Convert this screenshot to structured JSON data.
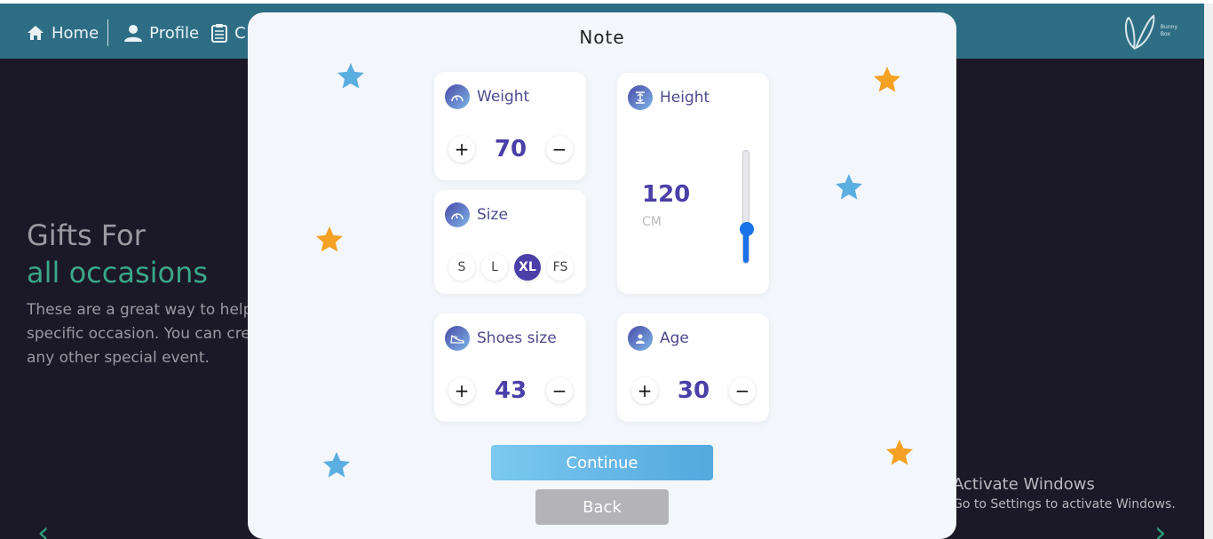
{
  "nav": {
    "items": [
      {
        "label": "Home",
        "icon": "home-icon"
      },
      {
        "label": "Profile",
        "icon": "user-icon"
      },
      {
        "label": "C",
        "icon": "clipboard-icon"
      }
    ]
  },
  "logo": {
    "line1": "Bunny",
    "line2": "Box"
  },
  "hero": {
    "title_line1": "Gifts For",
    "title_line2": "all occasions",
    "description": [
      "These are a great way to help",
      "specific occasion. You can cre",
      "any other special event."
    ]
  },
  "watermark": {
    "line1": "Activate Windows",
    "line2": "Go to Settings to activate Windows."
  },
  "modal": {
    "title": "Note",
    "weight": {
      "label": "Weight",
      "value": "70",
      "plus": "+",
      "minus": "−"
    },
    "size": {
      "label": "Size",
      "options": [
        "S",
        "L",
        "XL",
        "FS"
      ],
      "selected": "XL"
    },
    "height": {
      "label": "Height",
      "value": "120",
      "unit": "CM",
      "slider_fraction": 0.3
    },
    "shoes": {
      "label": "Shoes size",
      "value": "43",
      "plus": "+",
      "minus": "−"
    },
    "age": {
      "label": "Age",
      "value": "30",
      "plus": "+",
      "minus": "−"
    },
    "continue_label": "Continue",
    "back_label": "Back"
  },
  "colors": {
    "accent": "#4b3fa8",
    "topbar": "#2e6e85",
    "hero_green": "#3aa789",
    "star_blue": "#5aaee0",
    "star_orange": "#f4a124"
  }
}
